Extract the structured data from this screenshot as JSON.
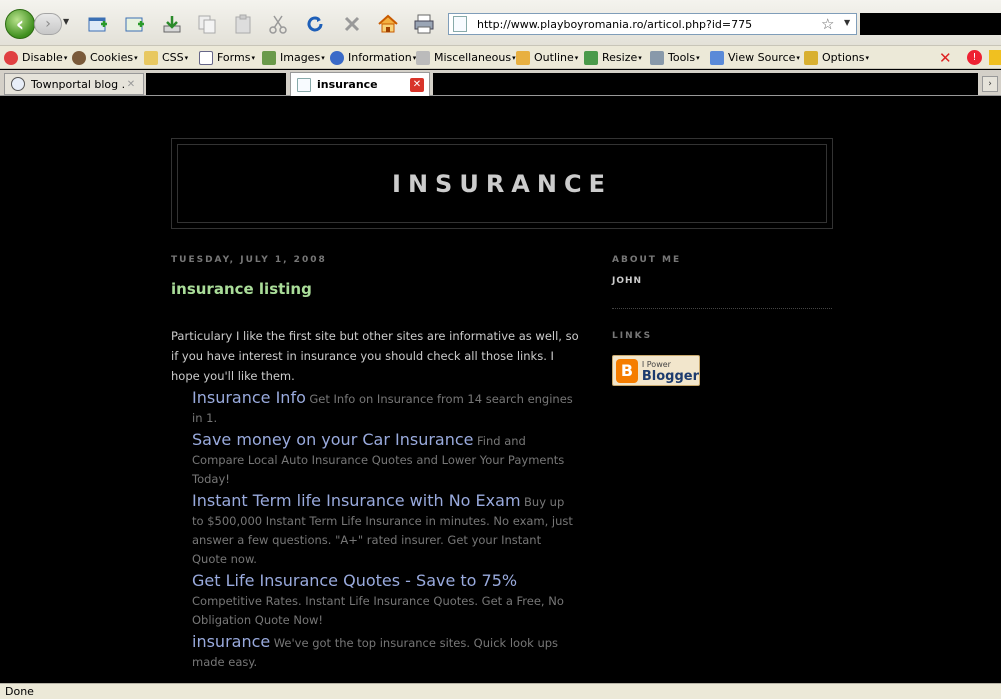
{
  "browser": {
    "url": "http://www.playboyromania.ro/articol.php?id=775",
    "toolbar_icons": [
      "new-tab-icon",
      "new-window-icon",
      "download-icon",
      "copy-icon",
      "paste-icon",
      "cut-icon",
      "reload-icon",
      "stop-icon",
      "home-icon",
      "print-icon"
    ],
    "devbar": {
      "disable": "Disable",
      "cookies": "Cookies",
      "css": "CSS",
      "forms": "Forms",
      "images": "Images",
      "information": "Information",
      "miscellaneous": "Miscellaneous",
      "outline": "Outline",
      "resize": "Resize",
      "tools": "Tools",
      "view_source": "View Source",
      "options": "Options"
    },
    "tabs": [
      {
        "label": "Townportal blog ...",
        "active": false
      },
      {
        "label": "insurance",
        "active": true
      }
    ],
    "status": "Done"
  },
  "blog": {
    "title": "Insurance",
    "post": {
      "date": "Tuesday, July 1, 2008",
      "title": "insurance listing",
      "intro": "Particulary I like the first site but other sites are informative as well, so if you have interest in insurance you should check all those links. I hope you'll like them.",
      "ads": [
        {
          "title": "Insurance Info",
          "desc": "Get Info on Insurance from 14 search engines in 1."
        },
        {
          "title": "Save money on your Car Insurance",
          "desc": "Find and Compare Local Auto Insurance Quotes and Lower Your Payments Today!"
        },
        {
          "title": "Instant Term life Insurance with No Exam",
          "desc": "Buy up to $500,000 Instant Term Life Insurance in minutes. No exam, just answer a few questions. \"A+\" rated insurer. Get your Instant Quote now."
        },
        {
          "title": "Get Life Insurance Quotes - Save to 75%",
          "desc": "Competitive Rates. Instant Life Insurance Quotes. Get a Free, No Obligation Quote Now!"
        },
        {
          "title": "insurance",
          "desc": "We've got the top insurance sites. Quick look ups made easy."
        }
      ]
    },
    "sidebar": {
      "about_heading": "About Me",
      "profile_name": "John",
      "links_heading": "Links",
      "badge_small": "I Power",
      "badge_big": "Blogger",
      "badge_logo": "B"
    }
  },
  "colors": {
    "post_title": "#aadd99",
    "ad_link": "#99aadd",
    "page_bg": "#000000"
  }
}
